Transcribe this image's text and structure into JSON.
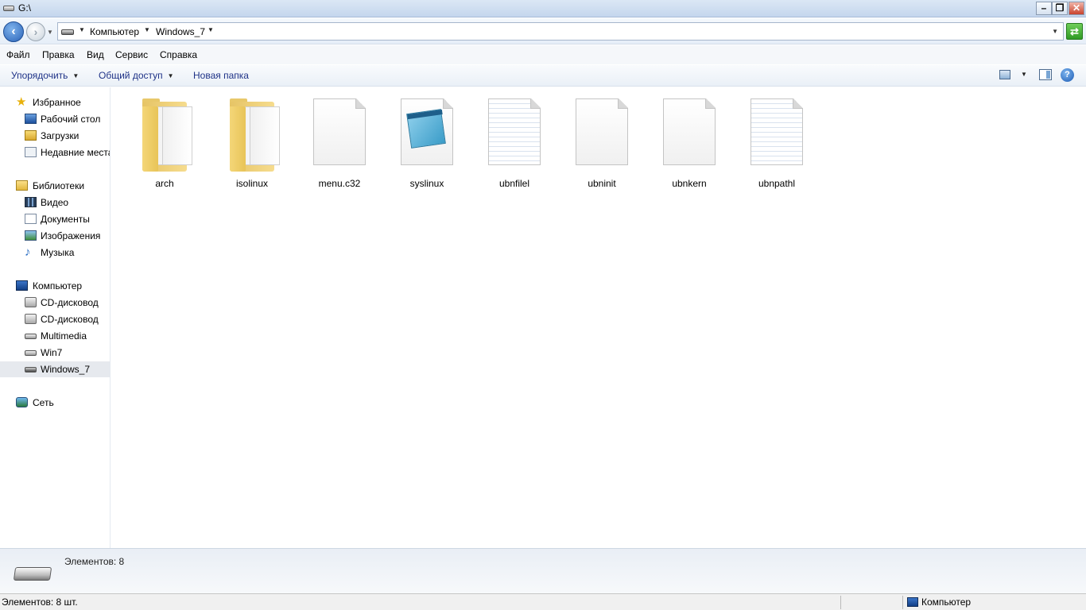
{
  "window": {
    "title": "G:\\"
  },
  "window_buttons": {
    "minimize": "–",
    "maximize": "❐",
    "close": "✕"
  },
  "address_bar": {
    "crumbs": [
      "Компьютер",
      "Windows_7"
    ]
  },
  "menu": [
    "Файл",
    "Правка",
    "Вид",
    "Сервис",
    "Справка"
  ],
  "commands": {
    "organize": "Упорядочить",
    "share": "Общий доступ",
    "new_folder": "Новая папка"
  },
  "nav": {
    "favorites": {
      "label": "Избранное",
      "items": [
        "Рабочий стол",
        "Загрузки",
        "Недавние места"
      ]
    },
    "libraries": {
      "label": "Библиотеки",
      "items": [
        "Видео",
        "Документы",
        "Изображения",
        "Музыка"
      ]
    },
    "computer": {
      "label": "Компьютер",
      "items": [
        "CD-дисковод",
        "CD-дисковод",
        "Multimedia",
        "Win7",
        "Windows_7"
      ],
      "selected": "Windows_7"
    },
    "network": {
      "label": "Сеть"
    }
  },
  "files": [
    {
      "name": "arch",
      "icon": "folder-icon"
    },
    {
      "name": "isolinux",
      "icon": "folder-icon"
    },
    {
      "name": "menu.c32",
      "icon": "blank-file-icon"
    },
    {
      "name": "syslinux",
      "icon": "notepad-file-icon"
    },
    {
      "name": "ubnfilel",
      "icon": "text-file-icon"
    },
    {
      "name": "ubninit",
      "icon": "blank-file-icon"
    },
    {
      "name": "ubnkern",
      "icon": "blank-file-icon"
    },
    {
      "name": "ubnpathl",
      "icon": "text-file-icon"
    }
  ],
  "details": {
    "count_text": "Элементов: 8"
  },
  "status": {
    "left": "Элементов: 8 шт.",
    "right": "Компьютер"
  }
}
